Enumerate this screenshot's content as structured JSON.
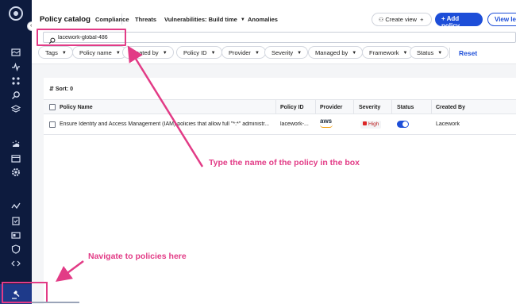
{
  "header": {
    "title": "Policy catalog",
    "tabs": [
      {
        "label": "Compliance"
      },
      {
        "label": "Threats"
      },
      {
        "label": "Vulnerabilities: Build time"
      },
      {
        "label": "Anomalies"
      }
    ],
    "create_view": "Create view",
    "add_policy": "+ Add policy",
    "view_legacy": "View leg"
  },
  "rail": {
    "collapse_label": "«"
  },
  "search": {
    "value": "lacework-global-486"
  },
  "filters": {
    "chips": [
      "Tags",
      "Policy name",
      "Created by",
      "Policy ID",
      "Provider",
      "Severity",
      "Managed by",
      "Framework",
      "Status"
    ],
    "reset": "Reset"
  },
  "table": {
    "sort_label": "Sort: 0",
    "columns": [
      "Policy Name",
      "Policy ID",
      "Provider",
      "Severity",
      "Status",
      "Created By"
    ],
    "rows": [
      {
        "policy_name": "Ensure Identity and Access Management (IAM) policies that allow full \"*:*\" administr...",
        "policy_id": "lacework-...",
        "provider": "aws",
        "severity": "High",
        "status": "enabled",
        "created_by": "Lacework"
      }
    ]
  },
  "annotations": {
    "search_hint": "Type the name of the policy in the box",
    "nav_hint": "Navigate to policies here"
  },
  "colors": {
    "annotation": "#e23b86",
    "primary": "#1d4ed8",
    "rail": "#0d1b3e"
  }
}
